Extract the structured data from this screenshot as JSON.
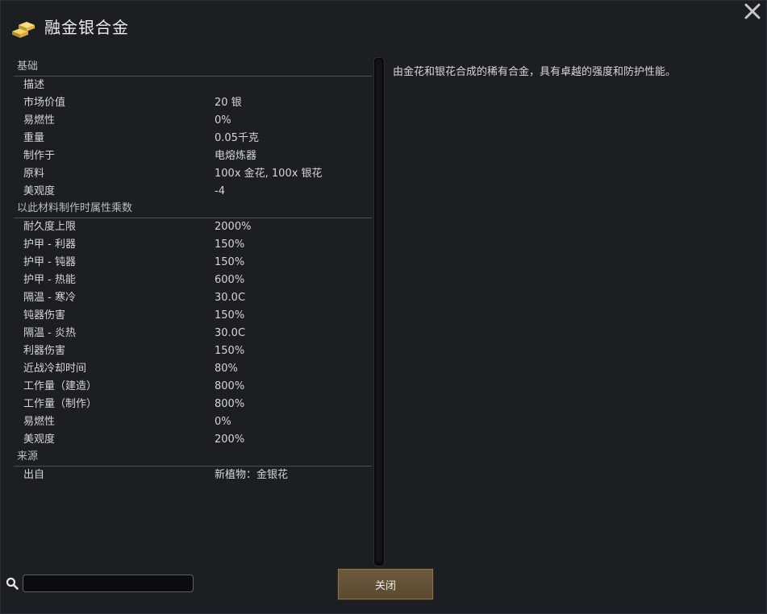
{
  "window": {
    "title": "融金银合金"
  },
  "sections": [
    {
      "header": "基础",
      "rows": [
        {
          "label": "描述",
          "value": ""
        },
        {
          "label": "市场价值",
          "value": "20 银"
        },
        {
          "label": "易燃性",
          "value": "0%"
        },
        {
          "label": "重量",
          "value": "0.05千克"
        },
        {
          "label": "制作于",
          "value": "电熔炼器"
        },
        {
          "label": "原料",
          "value": "100x 金花, 100x 银花"
        },
        {
          "label": "美观度",
          "value": "-4"
        }
      ]
    },
    {
      "header": "以此材料制作时属性乘数",
      "rows": [
        {
          "label": "耐久度上限",
          "value": "2000%"
        },
        {
          "label": "护甲 - 利器",
          "value": "150%"
        },
        {
          "label": "护甲 - 钝器",
          "value": "150%"
        },
        {
          "label": "护甲 - 热能",
          "value": "600%"
        },
        {
          "label": "隔温 - 寒冷",
          "value": "30.0C"
        },
        {
          "label": "钝器伤害",
          "value": "150%"
        },
        {
          "label": "隔温 - 炎热",
          "value": "30.0C"
        },
        {
          "label": "利器伤害",
          "value": "150%"
        },
        {
          "label": "近战冷却时间",
          "value": "80%"
        },
        {
          "label": "工作量（建造）",
          "value": "800%"
        },
        {
          "label": "工作量（制作）",
          "value": "800%"
        },
        {
          "label": "易燃性",
          "value": "0%"
        },
        {
          "label": "美观度",
          "value": "200%"
        }
      ]
    },
    {
      "header": "来源",
      "rows": [
        {
          "label": "出自",
          "value": "新植物：金银花"
        }
      ]
    }
  ],
  "description": "由金花和银花合成的稀有合金，具有卓越的强度和防护性能。",
  "search": {
    "value": ""
  },
  "buttons": {
    "close_label": "关闭"
  },
  "icons": {
    "title": "gold-bars-icon",
    "close": "close-icon",
    "search": "search-icon"
  },
  "colors": {
    "background": "#1b1e22",
    "button": "#6c5a3c",
    "gold": "#e2b94a"
  }
}
